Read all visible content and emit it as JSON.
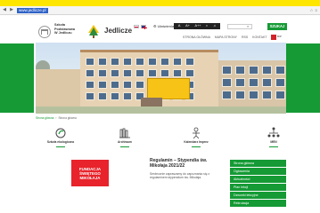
{
  "browser": {
    "url": "www.jedlicze.pl",
    "nav_icons": [
      "back-icon",
      "forward-icon",
      "refresh-icon"
    ],
    "tools": [
      "star-icon",
      "menu-icon"
    ]
  },
  "header": {
    "school_lines": [
      "Szkoła",
      "Podstawowa",
      "W Jedliczu"
    ],
    "city": "Jedlicze",
    "wcag_label": "Ułatwienia",
    "access_symbols": [
      "A",
      "A+",
      "A++",
      "◐",
      "♫"
    ],
    "search_placeholder": "",
    "search_button": "SZUKAJ",
    "top_links": [
      "STRONA GŁÓWNA",
      "MAPA STRONY",
      "RSS",
      "KONTAKT"
    ],
    "bip_label": "BIP"
  },
  "breadcrumb": {
    "home": "Strona główna",
    "current": "Strona główna"
  },
  "quick_links": [
    {
      "label": "Szkoła ekologiczna",
      "icon": "eco-icon"
    },
    {
      "label": "Archiwum",
      "icon": "books-icon"
    },
    {
      "label": "Kalendarz Imprez",
      "icon": "people-icon"
    },
    {
      "label": "MEN",
      "icon": "org-chart-icon"
    }
  ],
  "fundacja": {
    "lines": [
      "FUNDACJA",
      "ŚWIĘTEGO",
      "MIKOŁAJA"
    ]
  },
  "news": {
    "title": "Regulamin – Stypendia św. Mikołaja 2021/22",
    "text": "Serdecznie zapraszamy do zapoznania się z regulaminem stypendium św. Mikołaja."
  },
  "menu": {
    "items": [
      "Strona główna",
      "Ogłoszenia",
      "Aktualności",
      "Plan lekcji",
      "Dzwonki lekcyjne",
      "Rekrutacja"
    ]
  },
  "colors": {
    "brand_green": "#159a35",
    "fundacja_red": "#e8232b",
    "toolbar_yellow": "#ffe600"
  }
}
